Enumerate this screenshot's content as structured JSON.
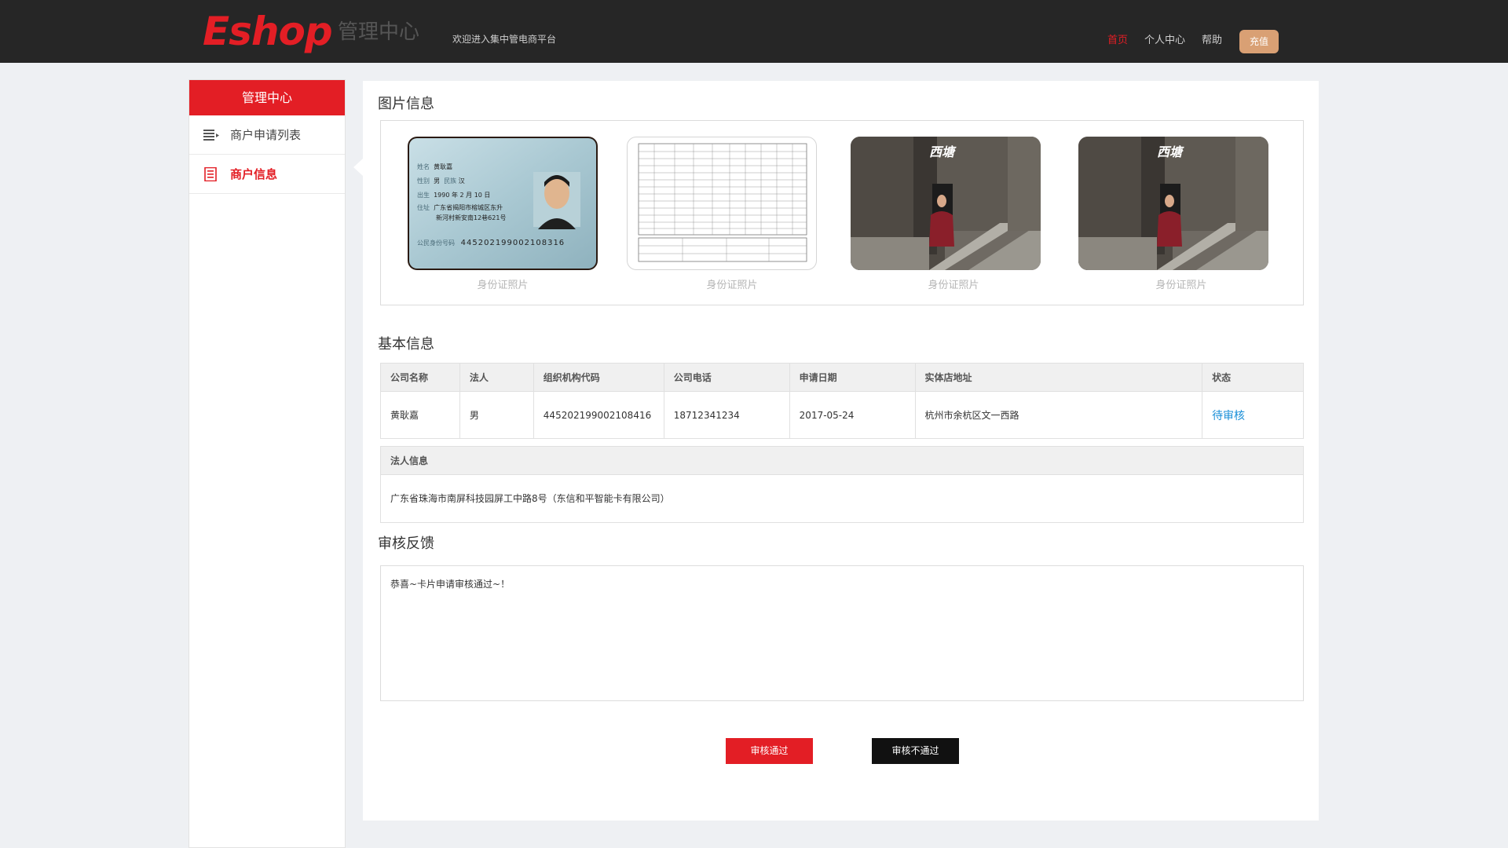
{
  "header": {
    "logo": "Eshop",
    "subtitle": "管理中心",
    "welcome": "欢迎进入集中管电商平台",
    "nav": {
      "home": "首页",
      "personal": "个人中心",
      "help": "帮助",
      "recharge": "充值"
    }
  },
  "sidebar": {
    "title": "管理中心",
    "items": [
      {
        "label": "商户申请列表",
        "icon": "list-icon"
      },
      {
        "label": "商户信息",
        "icon": "document-icon"
      }
    ]
  },
  "photos": {
    "title": "图片信息",
    "items": [
      {
        "caption": "身份证照片"
      },
      {
        "caption": "身份证照片"
      },
      {
        "caption": "身份证照片"
      },
      {
        "caption": "身份证照片"
      }
    ],
    "id_card": {
      "name_label": "姓名",
      "name_value": "黄耿嘉",
      "gender_label": "性别",
      "gender_value": "男",
      "ethnicity_label": "民族",
      "ethnicity_value": "汉",
      "birth_label": "出生",
      "birth_value": "1990 年 2 月 10 日",
      "address_label": "住址",
      "address_line1": "广东省揭阳市榕城区东升",
      "address_line2": "新河村新安南12巷621号",
      "id_label": "公民身份号码",
      "id_value": "445202199002108316"
    },
    "watermark": "西塘"
  },
  "basic_info": {
    "title": "基本信息",
    "columns": [
      "公司名称",
      "法人",
      "组织机构代码",
      "公司电话",
      "申请日期",
      "实体店地址",
      "状态"
    ],
    "row": {
      "company": "黄耿嘉",
      "legal_person": "男",
      "org_code": "445202199002108416",
      "phone": "18712341234",
      "date": "2017-05-24",
      "address": "杭州市余杭区文一西路",
      "status": "待审核"
    },
    "legal_info_label": "法人信息",
    "legal_info_value": "广东省珠海市南屏科技园屏工中路8号（东信和平智能卡有限公司）"
  },
  "feedback": {
    "title": "审核反馈",
    "text": "恭喜~卡片申请审核通过~！"
  },
  "actions": {
    "approve": "审核通过",
    "reject": "审核不通过"
  },
  "colors": {
    "brand": "#e31e25",
    "header_bg": "#262626",
    "recharge": "#d9a074",
    "link": "#1a8fd8"
  }
}
